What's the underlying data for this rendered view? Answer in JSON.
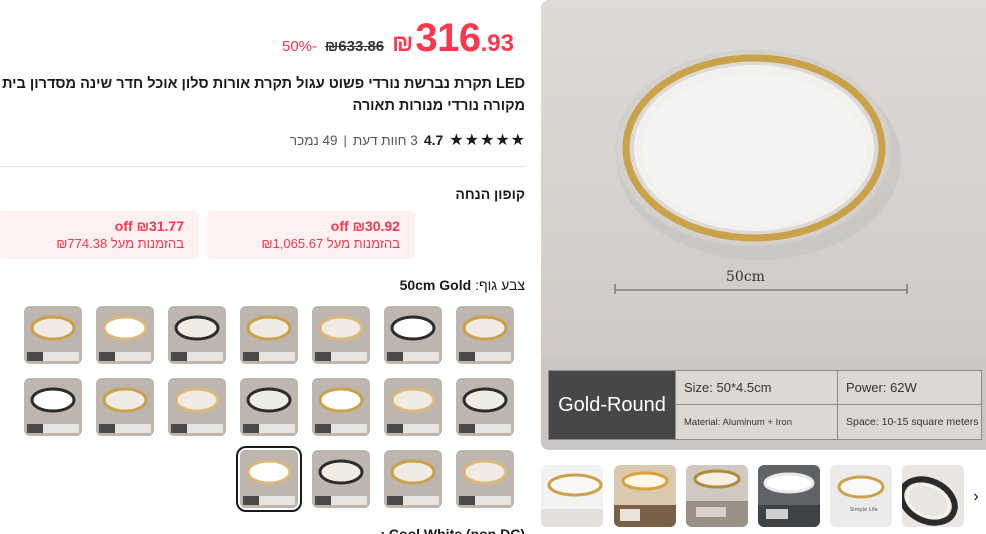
{
  "price": {
    "currency": "₪",
    "integer": "316",
    "decimal": ".93",
    "original": "₪633.86",
    "discount": "50%-"
  },
  "product": {
    "title": "LED תקרת נברשת נורדי פשוט עגול תקרת אורות סלון אוכל חדר שינה מסדרון בית מקורה נורדי מנורות תאורה"
  },
  "rating": {
    "stars": [
      "★",
      "★",
      "★",
      "★",
      "★"
    ],
    "score": "4.7",
    "reviews": "3 חוות דעת",
    "separator": "|",
    "sold": "49 נמכר"
  },
  "coupons": {
    "title": "קופון הנחה",
    "items": [
      {
        "off": "₪30.92 off",
        "min": "בהזמנות מעל ₪1,065.67"
      },
      {
        "off": "₪31.77 off",
        "min": "בהזמנות מעל ₪774.38"
      }
    ]
  },
  "color": {
    "label": "צבע גוף:",
    "selected": "50cm Gold"
  },
  "next_option_label": "Cool White (non DC) :",
  "gallery": {
    "main_caption": "50cm",
    "spec": {
      "name": "Gold-Round",
      "size": "Size: 50*4.5cm",
      "power": "Power: 62W",
      "material": "Material: Aluminum + Iron",
      "space": "Space: 10-15 square meters"
    },
    "next_icon": "›"
  },
  "colors": {
    "accent": "#fd384f",
    "coupon_bg": "#fff0f1",
    "gold": "#c9a24a"
  }
}
